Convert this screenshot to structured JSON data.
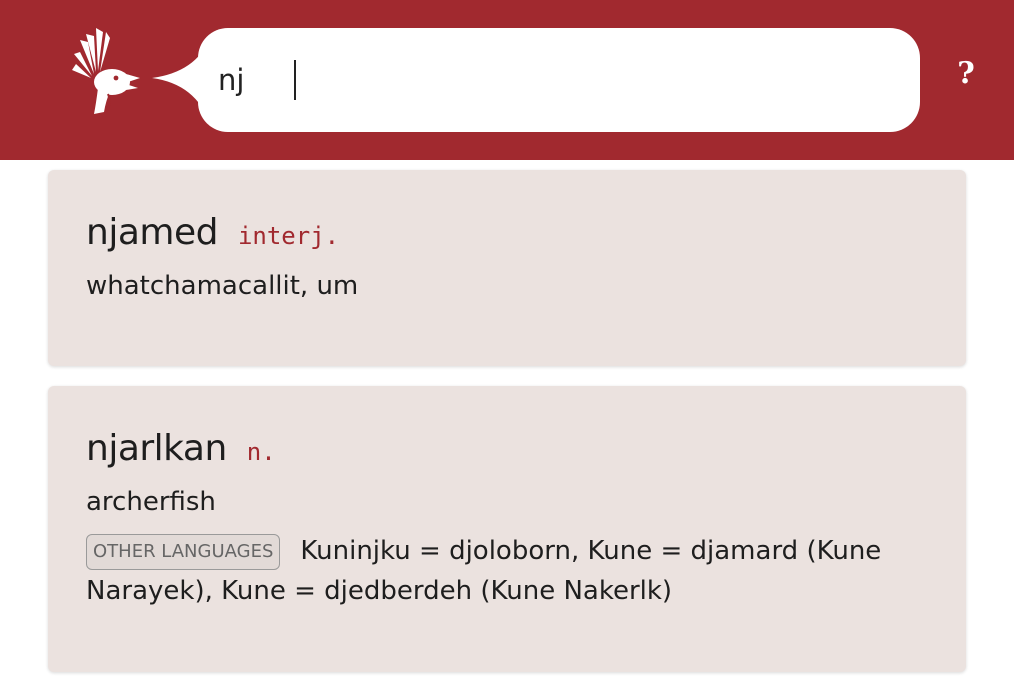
{
  "search": {
    "value": "nj"
  },
  "header": {
    "help_label": "?"
  },
  "entries": [
    {
      "headword": "njamed",
      "pos": "interj.",
      "gloss": "whatchamacallit, um"
    },
    {
      "headword": "njarlkan",
      "pos": "n.",
      "gloss": "archerfish",
      "other_languages_label": "OTHER LANGUAGES",
      "other_languages_text": "Kuninjku = djoloborn, Kune = djamard (Kune Narayek), Kune = djedberdeh (Kune Nakerlk)"
    }
  ],
  "colors": {
    "brand": "#a1292f",
    "card_bg": "#ebe2df",
    "pos": "#a1292f"
  }
}
